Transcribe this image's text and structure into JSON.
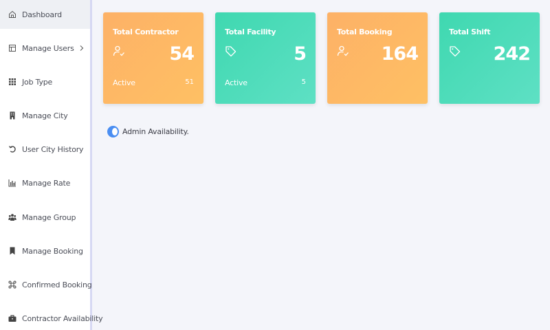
{
  "sidebar": {
    "items": [
      {
        "label": "Dashboard",
        "icon": "home-icon"
      },
      {
        "label": "Manage Users",
        "icon": "users-box-icon"
      },
      {
        "label": "Job Type",
        "icon": "grid-icon"
      },
      {
        "label": "Manage City",
        "icon": "building-icon"
      },
      {
        "label": "User City History",
        "icon": "history-icon"
      },
      {
        "label": "Manage Rate",
        "icon": "bar-chart-icon"
      },
      {
        "label": "Manage Group",
        "icon": "group-icon"
      },
      {
        "label": "Manage Booking",
        "icon": "bookmark-icon"
      },
      {
        "label": "Confirmed Booking",
        "icon": "command-icon"
      },
      {
        "label": "Contractor Availability",
        "icon": "briefcase-icon"
      }
    ]
  },
  "cards": [
    {
      "title": "Total Contractor",
      "value": "54",
      "sub_label": "Active",
      "sub_value": "51",
      "icon": "user-check-icon"
    },
    {
      "title": "Total Facility",
      "value": "5",
      "sub_label": "Active",
      "sub_value": "5",
      "icon": "tag-icon"
    },
    {
      "title": "Total Booking",
      "value": "164",
      "icon": "user-check-icon"
    },
    {
      "title": "Total Shift",
      "value": "242",
      "icon": "tag-icon"
    }
  ],
  "admin_availability": {
    "label": "Admin Availability.",
    "enabled": true
  },
  "colors": {
    "orange": "#fdb166",
    "teal": "#3fd8b0",
    "toggle": "#4a8ef2"
  }
}
